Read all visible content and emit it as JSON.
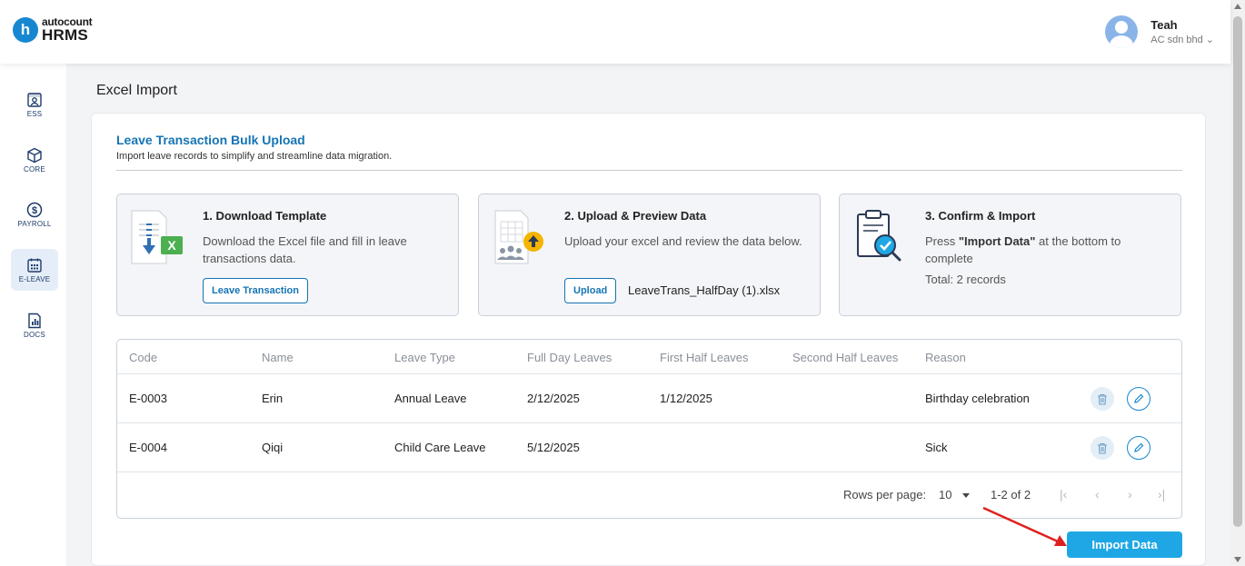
{
  "brand": {
    "logo_letter": "h",
    "logo_top": "autocount",
    "logo_bottom": "HRMS"
  },
  "user": {
    "name": "Teah",
    "company": "AC sdn bhd ⌄"
  },
  "sidebar": {
    "items": [
      {
        "label": "ESS",
        "icon": "ess-icon"
      },
      {
        "label": "CORE",
        "icon": "core-cube-icon"
      },
      {
        "label": "PAYROLL",
        "icon": "dollar-icon"
      },
      {
        "label": "E-LEAVE",
        "icon": "calendar-icon",
        "active": true
      },
      {
        "label": "DOCS",
        "icon": "docs-chart-icon"
      }
    ]
  },
  "page": {
    "title": "Excel Import"
  },
  "card": {
    "title": "Leave Transaction Bulk Upload",
    "subtitle": "Import leave records to simplify and streamline data migration."
  },
  "steps": [
    {
      "title": "1. Download Template",
      "desc": "Download the Excel file and fill in leave transactions data.",
      "button": "Leave Transaction"
    },
    {
      "title": "2. Upload & Preview Data",
      "desc": "Upload your excel and review the data below.",
      "button": "Upload",
      "file": "LeaveTrans_HalfDay (1).xlsx"
    },
    {
      "title": "3. Confirm & Import",
      "desc_prefix": "Press ",
      "desc_bold": "\"Import Data\"",
      "desc_suffix": " at the bottom to complete",
      "total": "Total: 2 records"
    }
  ],
  "table": {
    "columns": [
      "Code",
      "Name",
      "Leave Type",
      "Full Day Leaves",
      "First Half Leaves",
      "Second Half Leaves",
      "Reason"
    ],
    "rows": [
      [
        "E-0003",
        "Erin",
        "Annual Leave",
        "2/12/2025",
        "1/12/2025",
        "",
        "Birthday celebration"
      ],
      [
        "E-0004",
        "Qiqi",
        "Child Care Leave",
        "5/12/2025",
        "",
        "",
        "Sick"
      ]
    ]
  },
  "pagination": {
    "rows_per_page_label": "Rows per page:",
    "rows_per_page": "10",
    "range": "1-2 of 2"
  },
  "actions": {
    "import_label": "Import Data"
  },
  "colors": {
    "accent": "#1574b4",
    "import_button": "#1ea7e4",
    "annotation_arrow": "#e02020"
  }
}
